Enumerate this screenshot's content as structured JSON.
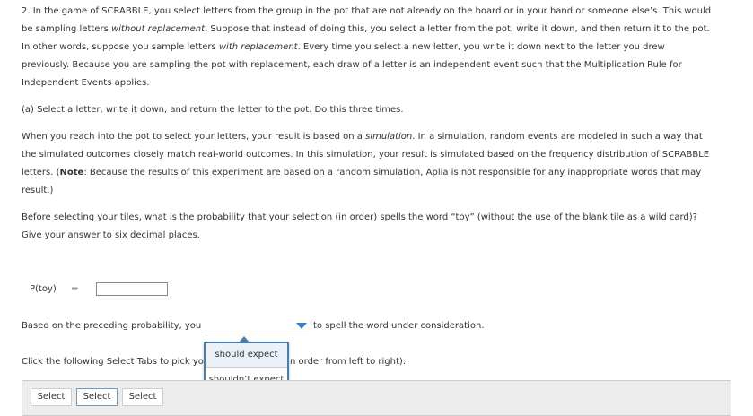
{
  "question": {
    "p1": {
      "a": "2. In the game of SCRABBLE, you select letters from the group in the pot that are not already on the board or in your hand or someone else’s. This would be sampling letters ",
      "b": "without replacement",
      "c": ". Suppose that instead of doing this, you select a letter from the pot, write it down, and then return it to the pot. In other words, suppose you sample letters ",
      "d": "with replacement",
      "e": ". Every time you select a new letter, you write it down next to the letter you drew previously. Because you are sampling the pot with replacement, each draw of a letter is an independent event such that the Multiplication Rule for Independent Events applies."
    },
    "p2": "(a) Select a letter, write it down, and return the letter to the pot. Do this three times.",
    "p3": {
      "a": "When you reach into the pot to select your letters, your result is based on a ",
      "b": "simulation",
      "c": ". In a simulation, random events are modeled in such a way that the simulated outcomes closely match real-world outcomes. In this simulation, your result is simulated based on the frequency distribution of SCRABBLE letters. (",
      "d": "Note",
      "e": ": Because the results of this experiment are based on a random simulation, Aplia is not responsible for any inappropriate words that may result.)"
    },
    "p4": "Before selecting your tiles, what is the probability that your selection (in order) spells the word “toy” (without the use of the blank tile as a wild card)? Give your answer to six decimal places."
  },
  "answer": {
    "label": "P(toy)",
    "equals": "=",
    "value": ""
  },
  "based_line": {
    "before": "Based on the preceding probability, you",
    "selected": "",
    "after": "to spell the word under consideration."
  },
  "click_line": {
    "left": "Click the following Select Tabs to pick yo",
    "right": "n order from left to right):"
  },
  "popup": {
    "options": [
      "should expect",
      "shouldn’t expect"
    ]
  },
  "tabs": [
    "Select",
    "Select",
    "Select"
  ],
  "colors": {
    "accent": "#3a7fc0",
    "popup_border": "#4a7dad",
    "highlight": "#eaf1f8"
  }
}
